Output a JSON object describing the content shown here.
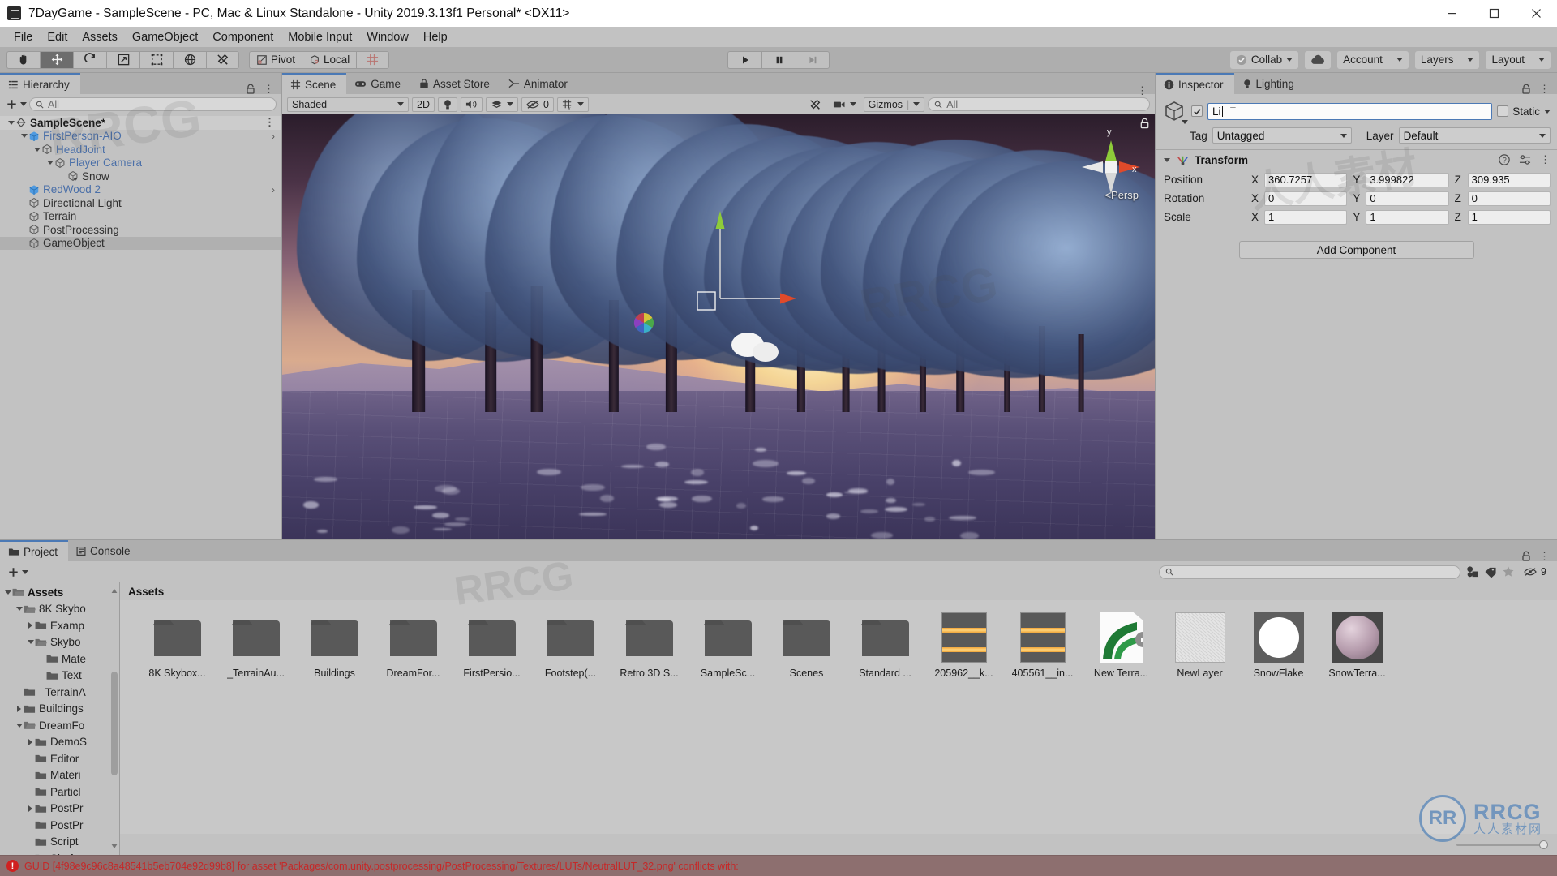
{
  "window": {
    "title": "7DayGame - SampleScene - PC, Mac & Linux Standalone - Unity 2019.3.13f1 Personal* <DX11>",
    "minimize": "minimize-button",
    "maximize": "maximize-button",
    "close": "close-button"
  },
  "menubar": {
    "items": [
      "File",
      "Edit",
      "Assets",
      "GameObject",
      "Component",
      "Mobile Input",
      "Window",
      "Help"
    ]
  },
  "toolbar": {
    "tools": [
      {
        "name": "hand-tool",
        "icon": "hand-icon",
        "active": false
      },
      {
        "name": "move-tool",
        "icon": "move-icon",
        "active": true
      },
      {
        "name": "rotate-tool",
        "icon": "rotate-icon",
        "active": false
      },
      {
        "name": "scale-tool",
        "icon": "scale-icon",
        "active": false
      },
      {
        "name": "rect-tool",
        "icon": "rect-icon",
        "active": false
      },
      {
        "name": "transform-tool",
        "icon": "transform-icon",
        "active": false
      },
      {
        "name": "custom-tool",
        "icon": "wrench-icon",
        "active": false
      }
    ],
    "pivot_label": "Pivot",
    "local_label": "Local",
    "grid_label": "grid-snap-icon",
    "play": "play-button",
    "pause": "pause-button",
    "step": "step-button",
    "collab_label": "Collab",
    "cloud_label": "cloud-icon",
    "account_label": "Account",
    "layers_label": "Layers",
    "layout_label": "Layout"
  },
  "hierarchy": {
    "tab_label": "Hierarchy",
    "search_placeholder": "All",
    "create_label": "+",
    "items": [
      {
        "label": "SampleScene*",
        "depth": 0,
        "icon": "scene-icon",
        "arrow": "down",
        "kind": "scene",
        "selected": false,
        "chevron": false
      },
      {
        "label": "FirstPerson-AIO",
        "depth": 1,
        "icon": "prefab-icon",
        "arrow": "down",
        "kind": "prefab",
        "selected": false,
        "chevron": true
      },
      {
        "label": "HeadJoint",
        "depth": 2,
        "icon": "gameobject-icon",
        "arrow": "down",
        "kind": "prefab-child",
        "selected": false,
        "chevron": false
      },
      {
        "label": "Player Camera",
        "depth": 3,
        "icon": "gameobject-icon",
        "arrow": "down",
        "kind": "prefab-child",
        "selected": false,
        "chevron": false
      },
      {
        "label": "Snow",
        "depth": 4,
        "icon": "gameobject-add-icon",
        "arrow": "none",
        "kind": "normal",
        "selected": false,
        "chevron": false
      },
      {
        "label": "RedWood 2",
        "depth": 1,
        "icon": "prefab-icon",
        "arrow": "none",
        "kind": "prefab",
        "selected": false,
        "chevron": true
      },
      {
        "label": "Directional Light",
        "depth": 1,
        "icon": "gameobject-icon",
        "arrow": "none",
        "kind": "normal",
        "selected": false,
        "chevron": false
      },
      {
        "label": "Terrain",
        "depth": 1,
        "icon": "gameobject-icon",
        "arrow": "none",
        "kind": "normal",
        "selected": false,
        "chevron": false
      },
      {
        "label": "PostProcessing",
        "depth": 1,
        "icon": "gameobject-icon",
        "arrow": "none",
        "kind": "normal",
        "selected": false,
        "chevron": false
      },
      {
        "label": "GameObject",
        "depth": 1,
        "icon": "gameobject-icon",
        "arrow": "none",
        "kind": "normal",
        "selected": true,
        "chevron": false
      }
    ]
  },
  "scene": {
    "tabs": [
      {
        "label": "Scene",
        "icon": "scene-grid-icon",
        "active": true
      },
      {
        "label": "Game",
        "icon": "gamepad-icon",
        "active": false
      },
      {
        "label": "Asset Store",
        "icon": "store-icon",
        "active": false
      },
      {
        "label": "Animator",
        "icon": "animator-icon",
        "active": false
      }
    ],
    "draw_mode": "Shaded",
    "mode_2d": "2D",
    "lighting_icon": "lighting-toggle-icon",
    "audio_icon": "audio-toggle-icon",
    "fx_icon": "effects-icon",
    "hidden_count": "0",
    "grid_icon": "scene-grid-visibility-icon",
    "component_icon": "component-tools-icon",
    "camera_icon": "scene-camera-icon",
    "gizmos_label": "Gizmos",
    "search_placeholder": "All",
    "axis_x": "x",
    "axis_y": "y",
    "persp_label": "Persp"
  },
  "inspector": {
    "tabs": [
      {
        "label": "Inspector",
        "icon": "info-icon",
        "active": true
      },
      {
        "label": "Lighting",
        "icon": "bulb-icon",
        "active": false
      }
    ],
    "object_name": "Li",
    "enabled": true,
    "static_label": "Static",
    "tag_label": "Tag",
    "tag_value": "Untagged",
    "layer_label": "Layer",
    "layer_value": "Default",
    "component": {
      "title": "Transform",
      "rows": [
        {
          "label": "Position",
          "x": "360.7257",
          "y": "3.999822",
          "z": "309.935"
        },
        {
          "label": "Rotation",
          "x": "0",
          "y": "0",
          "z": "0"
        },
        {
          "label": "Scale",
          "x": "1",
          "y": "1",
          "z": "1"
        }
      ]
    },
    "add_component_label": "Add Component"
  },
  "project": {
    "tabs": [
      {
        "label": "Project",
        "icon": "folder-icon",
        "active": true
      },
      {
        "label": "Console",
        "icon": "console-icon",
        "active": false
      }
    ],
    "create_label": "+",
    "search_placeholder": "",
    "icon_buttons": [
      "object-filter-icon",
      "label-filter-icon",
      "favorite-icon"
    ],
    "hidden_count": "9",
    "breadcrumb": "Assets",
    "tree": [
      {
        "label": "Assets",
        "depth": 0,
        "arrow": "down",
        "bold": true,
        "open": true
      },
      {
        "label": "8K Skybo",
        "depth": 1,
        "arrow": "down",
        "bold": false,
        "open": true
      },
      {
        "label": "Examp",
        "depth": 2,
        "arrow": "right",
        "bold": false,
        "open": false
      },
      {
        "label": "Skybo",
        "depth": 2,
        "arrow": "down",
        "bold": false,
        "open": true
      },
      {
        "label": "Mate",
        "depth": 3,
        "arrow": "none",
        "bold": false,
        "open": false
      },
      {
        "label": "Text",
        "depth": 3,
        "arrow": "none",
        "bold": false,
        "open": false
      },
      {
        "label": "_TerrainA",
        "depth": 1,
        "arrow": "none",
        "bold": false,
        "open": false
      },
      {
        "label": "Buildings",
        "depth": 1,
        "arrow": "right",
        "bold": false,
        "open": false
      },
      {
        "label": "DreamFo",
        "depth": 1,
        "arrow": "down",
        "bold": false,
        "open": true
      },
      {
        "label": "DemoS",
        "depth": 2,
        "arrow": "right",
        "bold": false,
        "open": false
      },
      {
        "label": "Editor",
        "depth": 2,
        "arrow": "none",
        "bold": false,
        "open": false
      },
      {
        "label": "Materi",
        "depth": 2,
        "arrow": "none",
        "bold": false,
        "open": false
      },
      {
        "label": "Particl",
        "depth": 2,
        "arrow": "none",
        "bold": false,
        "open": false
      },
      {
        "label": "PostPr",
        "depth": 2,
        "arrow": "right",
        "bold": false,
        "open": false
      },
      {
        "label": "PostPr",
        "depth": 2,
        "arrow": "none",
        "bold": false,
        "open": false
      },
      {
        "label": "Script",
        "depth": 2,
        "arrow": "none",
        "bold": false,
        "open": false
      },
      {
        "label": "Shaft",
        "depth": 2,
        "arrow": "none",
        "bold": false,
        "open": false
      }
    ],
    "assets": [
      {
        "label": "8K Skybox...",
        "type": "folder"
      },
      {
        "label": "_TerrainAu...",
        "type": "folder"
      },
      {
        "label": "Buildings",
        "type": "folder"
      },
      {
        "label": "DreamFor...",
        "type": "folder"
      },
      {
        "label": "FirstPersio...",
        "type": "folder"
      },
      {
        "label": "Footstep(...",
        "type": "folder"
      },
      {
        "label": "Retro 3D S...",
        "type": "folder"
      },
      {
        "label": "SampleSc...",
        "type": "folder"
      },
      {
        "label": "Scenes",
        "type": "folder"
      },
      {
        "label": "Standard ...",
        "type": "folder"
      },
      {
        "label": "205962__k...",
        "type": "audio"
      },
      {
        "label": "405561__in...",
        "type": "audio"
      },
      {
        "label": "New Terra...",
        "type": "terrain"
      },
      {
        "label": "NewLayer",
        "type": "texture-noise"
      },
      {
        "label": "SnowFlake",
        "type": "texture-circle"
      },
      {
        "label": "SnowTerra...",
        "type": "material-sphere"
      }
    ],
    "zoom_value": "100"
  },
  "statusbar": {
    "icon": "error-icon",
    "message": "GUID [4f98e9c96c8a48541b5eb704e92d99b8] for asset 'Packages/com.unity.postprocessing/PostProcessing/Textures/LUTs/NeutralLUT_32.png' conflicts with:"
  },
  "watermark": {
    "brand": "RRCG",
    "sub": "人人素材网",
    "mark": "RR"
  },
  "colors": {
    "accent": "#4b79b5",
    "error": "#c62828",
    "panel_bg": "#c2c2c2",
    "toolbar_bg": "#aeaeae",
    "axis_x": "#e04a2a",
    "axis_y": "#8ecb39"
  }
}
